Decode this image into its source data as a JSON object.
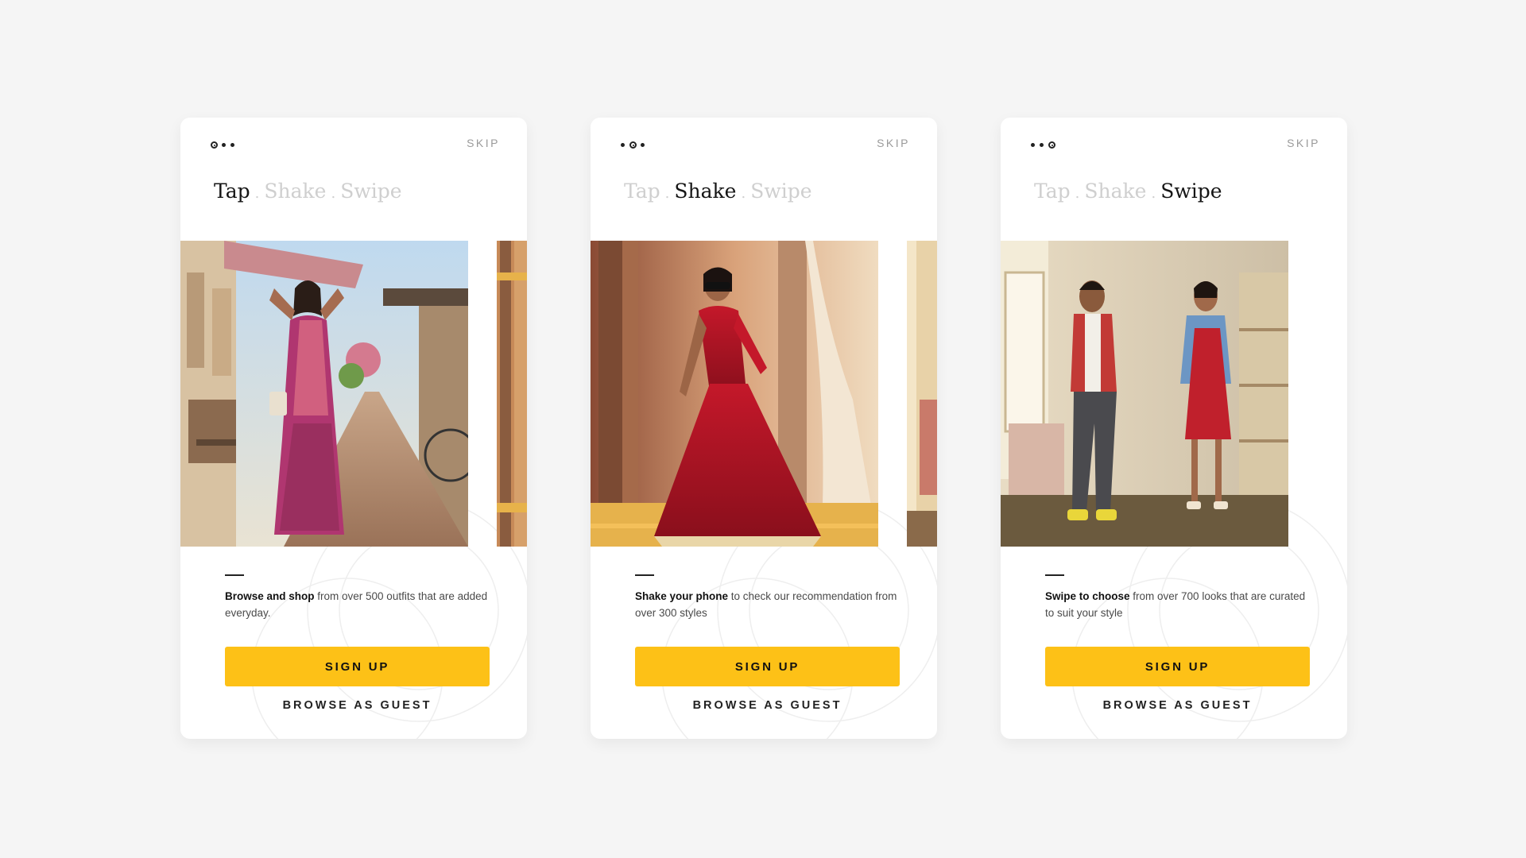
{
  "colors": {
    "background": "#f5f5f5",
    "card": "#ffffff",
    "accent": "#fdc117",
    "text_dark": "#111111",
    "text_muted": "#9a9a9a",
    "headline_inactive": "#cfcfcf"
  },
  "icons": {
    "pager": "three-dots-pager-icon"
  },
  "screens": [
    {
      "skip": "SKIP",
      "headline": {
        "word1": "Tap",
        "word2": "Shake",
        "word3": "Swipe",
        "separator": "."
      },
      "active_word": 1,
      "pager_active": 1,
      "image_main": "woman-in-saree-with-headphones-photo",
      "image_peek": "next-slide-peek-photo",
      "description": {
        "bold": "Browse and shop",
        "rest": " from over 500 outfits that are added everyday."
      },
      "signup": "SIGN UP",
      "guest": "BROWSE AS GUEST"
    },
    {
      "skip": "SKIP",
      "headline": {
        "word1": "Tap",
        "word2": "Shake",
        "word3": "Swipe",
        "separator": "."
      },
      "active_word": 2,
      "pager_active": 2,
      "image_main": "woman-in-red-anarkali-photo",
      "image_peek": "next-slide-peek-photo",
      "description": {
        "bold": "Shake your phone",
        "rest": " to check our recommendation from over 300 styles"
      },
      "signup": "SIGN UP",
      "guest": "BROWSE AS GUEST"
    },
    {
      "skip": "SKIP",
      "headline": {
        "word1": "Tap",
        "word2": "Shake",
        "word3": "Swipe",
        "separator": "."
      },
      "active_word": 3,
      "pager_active": 3,
      "image_main": "couple-dancing-in-living-room-photo",
      "description": {
        "bold": "Swipe to choose",
        "rest": " from over 700 looks that are curated to suit your style"
      },
      "signup": "SIGN UP",
      "guest": "BROWSE AS GUEST"
    }
  ]
}
